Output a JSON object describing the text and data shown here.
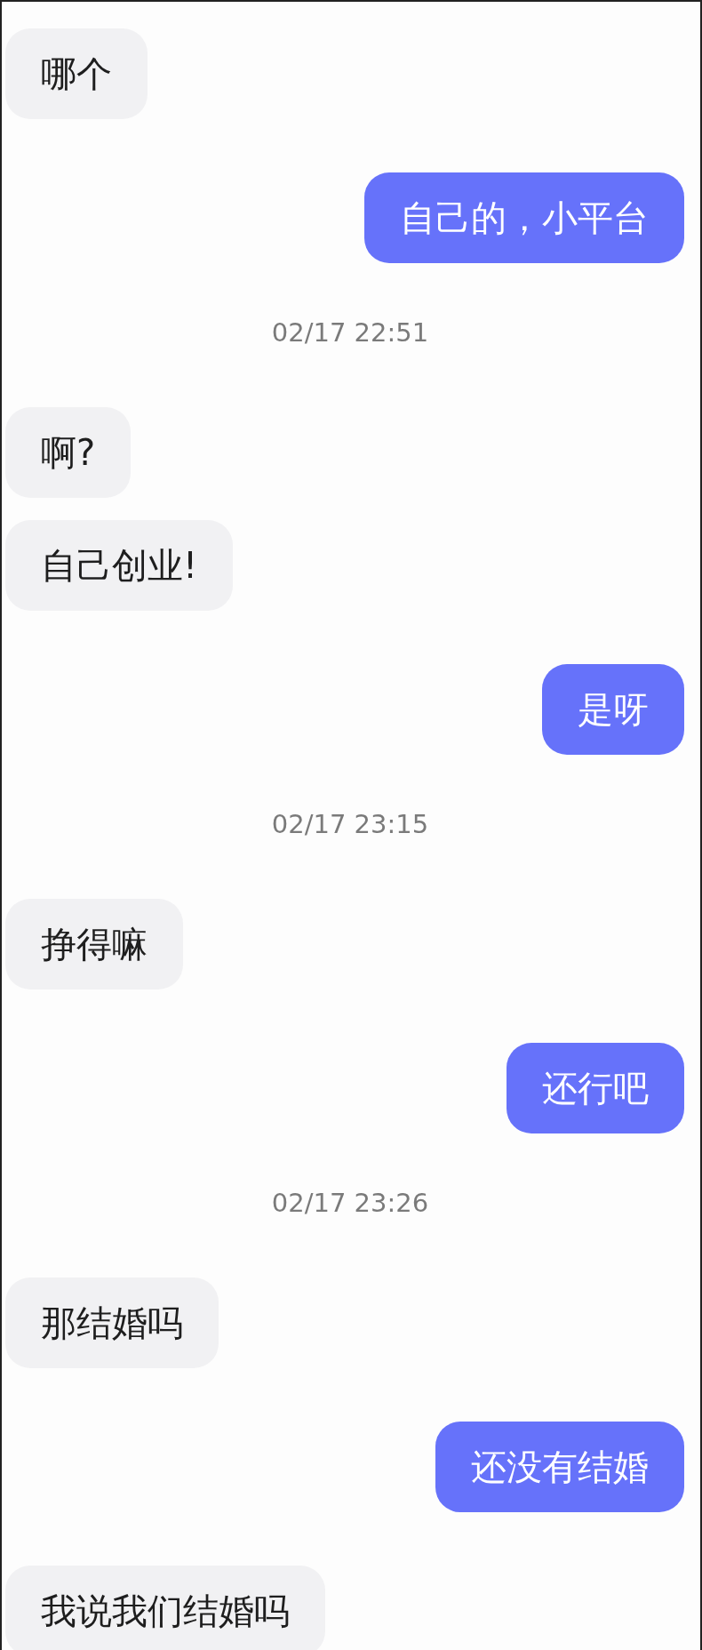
{
  "messages": [
    {
      "kind": "incoming",
      "text": "哪个"
    },
    {
      "kind": "outgoing",
      "text": "自己的，小平台"
    },
    {
      "kind": "timestamp",
      "text": "02/17 22:51"
    },
    {
      "kind": "incoming",
      "text": "啊?"
    },
    {
      "kind": "incoming",
      "text": "自己创业!"
    },
    {
      "kind": "outgoing",
      "text": "是呀"
    },
    {
      "kind": "timestamp",
      "text": "02/17 23:15"
    },
    {
      "kind": "incoming",
      "text": "挣得嘛"
    },
    {
      "kind": "outgoing",
      "text": "还行吧"
    },
    {
      "kind": "timestamp",
      "text": "02/17 23:26"
    },
    {
      "kind": "incoming",
      "text": "那结婚吗"
    },
    {
      "kind": "outgoing",
      "text": "还没有结婚"
    },
    {
      "kind": "incoming",
      "text": "我说我们结婚吗"
    }
  ]
}
